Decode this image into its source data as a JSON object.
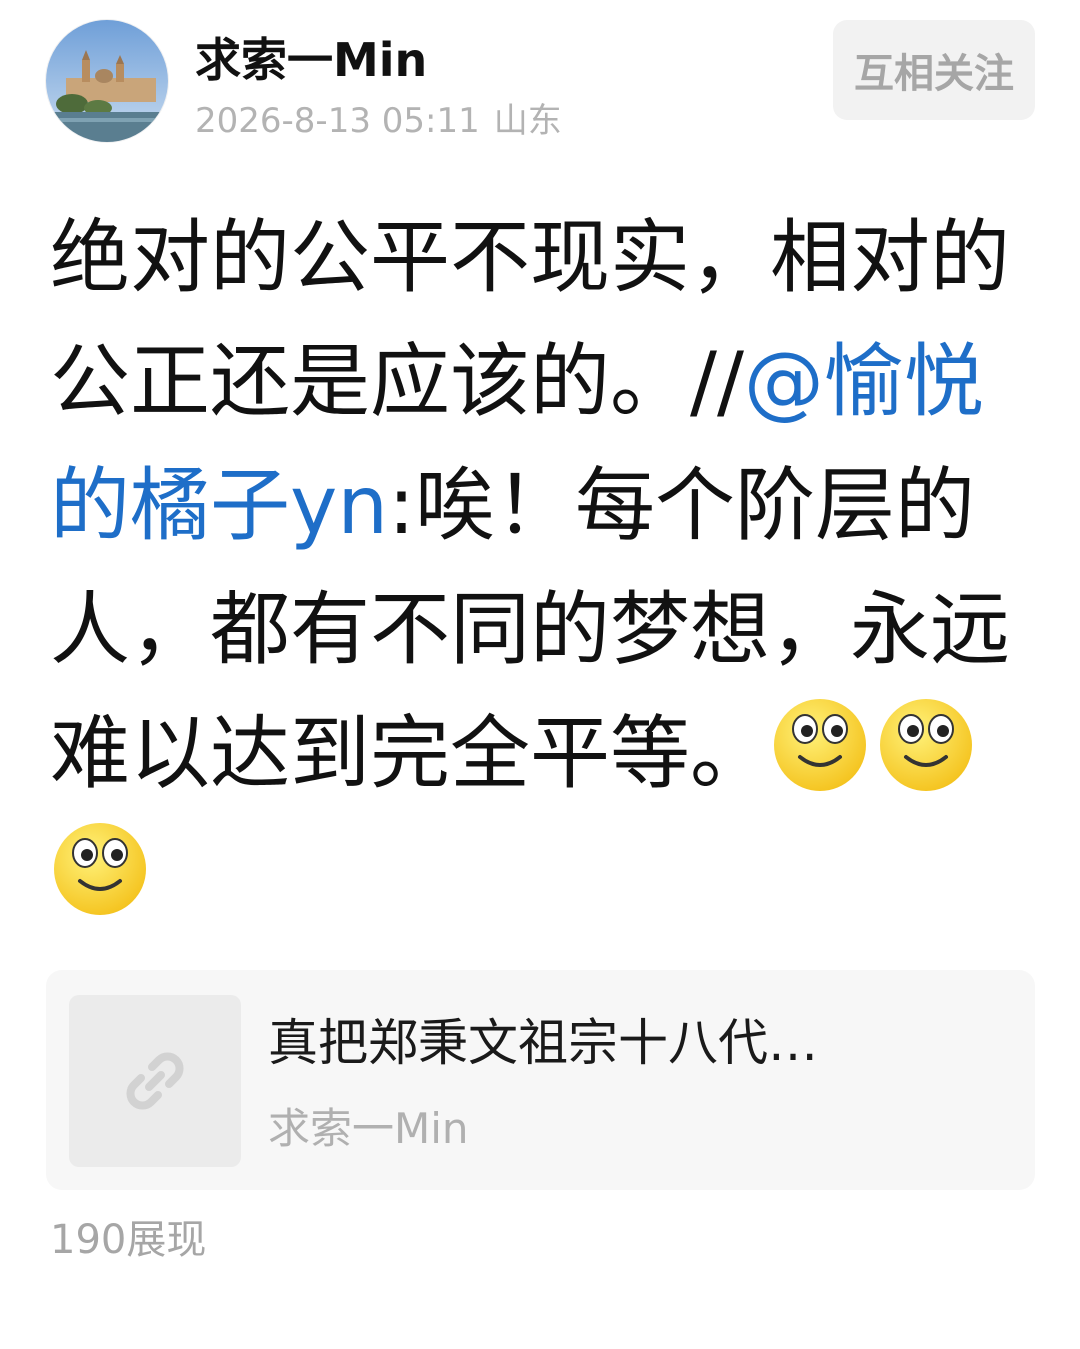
{
  "author": {
    "name": "求索一Min",
    "timestamp": "2026-8-13 05:11",
    "location": "山东",
    "avatar_icon": "avatar-landscape-icon"
  },
  "follow_button": {
    "label": "互相关注"
  },
  "post": {
    "text_before_mention": "绝对的公平不现实，相对的公正还是应该的。//",
    "mention": "@愉悦的橘子yn",
    "text_after_mention": ":唉！每个阶层的人，都有不同的梦想，永远难以达到完全平等。",
    "emoji_icon": "smile-emoji-icon",
    "emoji_count": 3
  },
  "link_card": {
    "title": "真把郑秉文祖宗十八代…",
    "source": "求索一Min",
    "thumb_icon": "link-icon"
  },
  "stats": {
    "views": "190展现"
  },
  "colors": {
    "mention": "#1e6ec8",
    "muted": "#b3b3b3",
    "button_bg": "#f2f2f2",
    "card_bg": "#f7f7f7"
  }
}
